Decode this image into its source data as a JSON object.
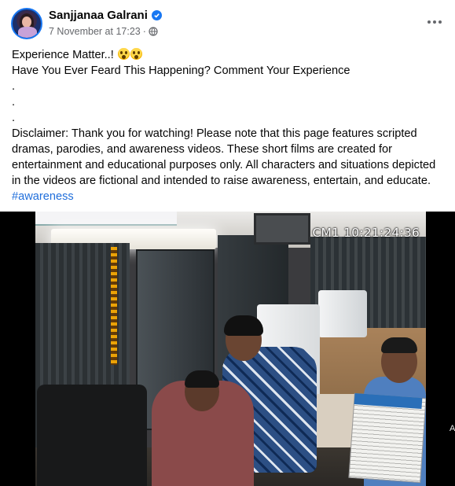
{
  "post": {
    "author": "Sanjjanaa Galrani",
    "verified_icon": "verified-badge-icon",
    "timestamp": "7 November at 17:23",
    "separator": "·",
    "audience_icon": "globe-icon",
    "more_icon": "more-options-icon",
    "text_lines": [
      "Experience Matter..!",
      "Have You Ever Feard This Happening? Comment Your Experience",
      ".",
      ".",
      ".",
      "Disclaimer: Thank you for watching! Please note that this page features scripted",
      "dramas, parodies, and awareness videos. These short films are created for",
      "entertainment and educational purposes only. All characters and situations depicted",
      "in the videos are fictional and intended to raise awareness, entertain, and educate."
    ],
    "hashtag": "#awareness",
    "emojis": [
      "astonished-face-emoji",
      "astonished-face-emoji"
    ]
  },
  "video": {
    "overlay_text": "CM1 10:21:24:36",
    "edge_text": "A"
  },
  "colors": {
    "link": "#216fdb",
    "secondary_text": "#65676b",
    "verified": "#1877f2"
  }
}
